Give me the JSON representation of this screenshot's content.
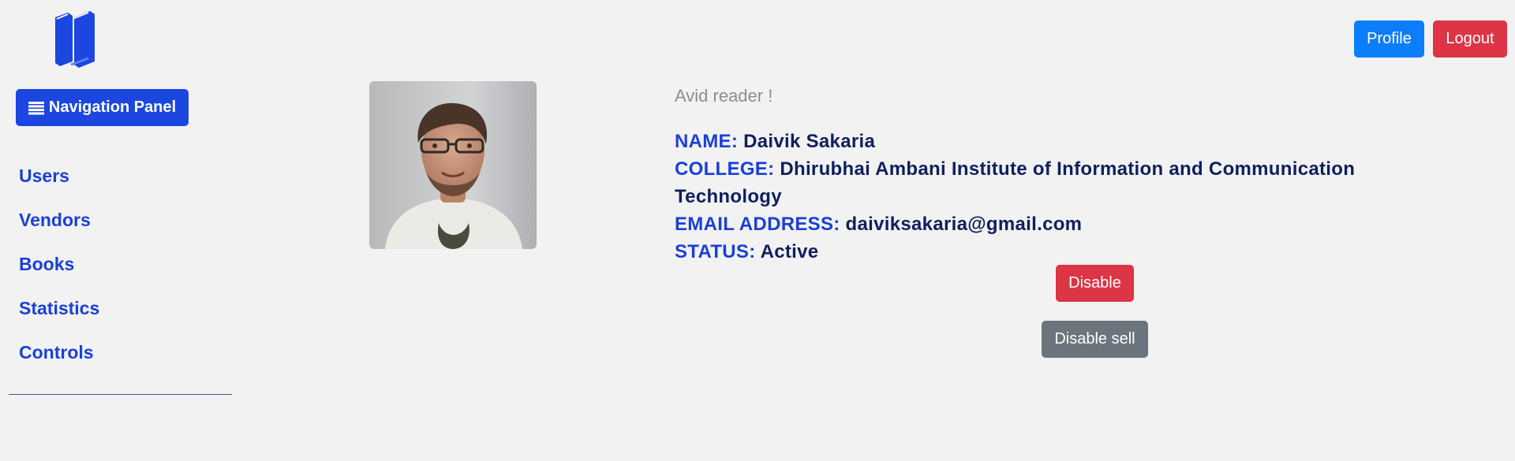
{
  "header": {
    "logo_icon": "books-icon",
    "profile_label": "Profile",
    "logout_label": "Logout"
  },
  "sidebar": {
    "toggle_icon": "list-icon",
    "toggle_label": "Navigation Panel",
    "items": [
      {
        "label": "Users"
      },
      {
        "label": "Vendors"
      },
      {
        "label": "Books"
      },
      {
        "label": "Statistics"
      },
      {
        "label": "Controls"
      }
    ]
  },
  "profile": {
    "avatar": "user-photo",
    "bio": "Avid reader !",
    "name_key": "NAME:",
    "name": "Daivik Sakaria",
    "college_key": "COLLEGE:",
    "college": "Dhirubhai Ambani Institute of Information and Communication Technology",
    "email_key": "EMAIL ADDRESS:",
    "email": "daiviksakaria@gmail.com",
    "status_key": "STATUS:",
    "status": "Active"
  },
  "actions": {
    "disable_label": "Disable",
    "disable_sell_label": "Disable sell"
  },
  "colors": {
    "background": "#f2f2f2",
    "primary": "#1b47e0",
    "profile_button": "#0d7ef9",
    "danger": "#dc3545",
    "secondary": "#6c757d",
    "value_text": "#0f1f5c",
    "bio_text": "#8e8e8e"
  }
}
